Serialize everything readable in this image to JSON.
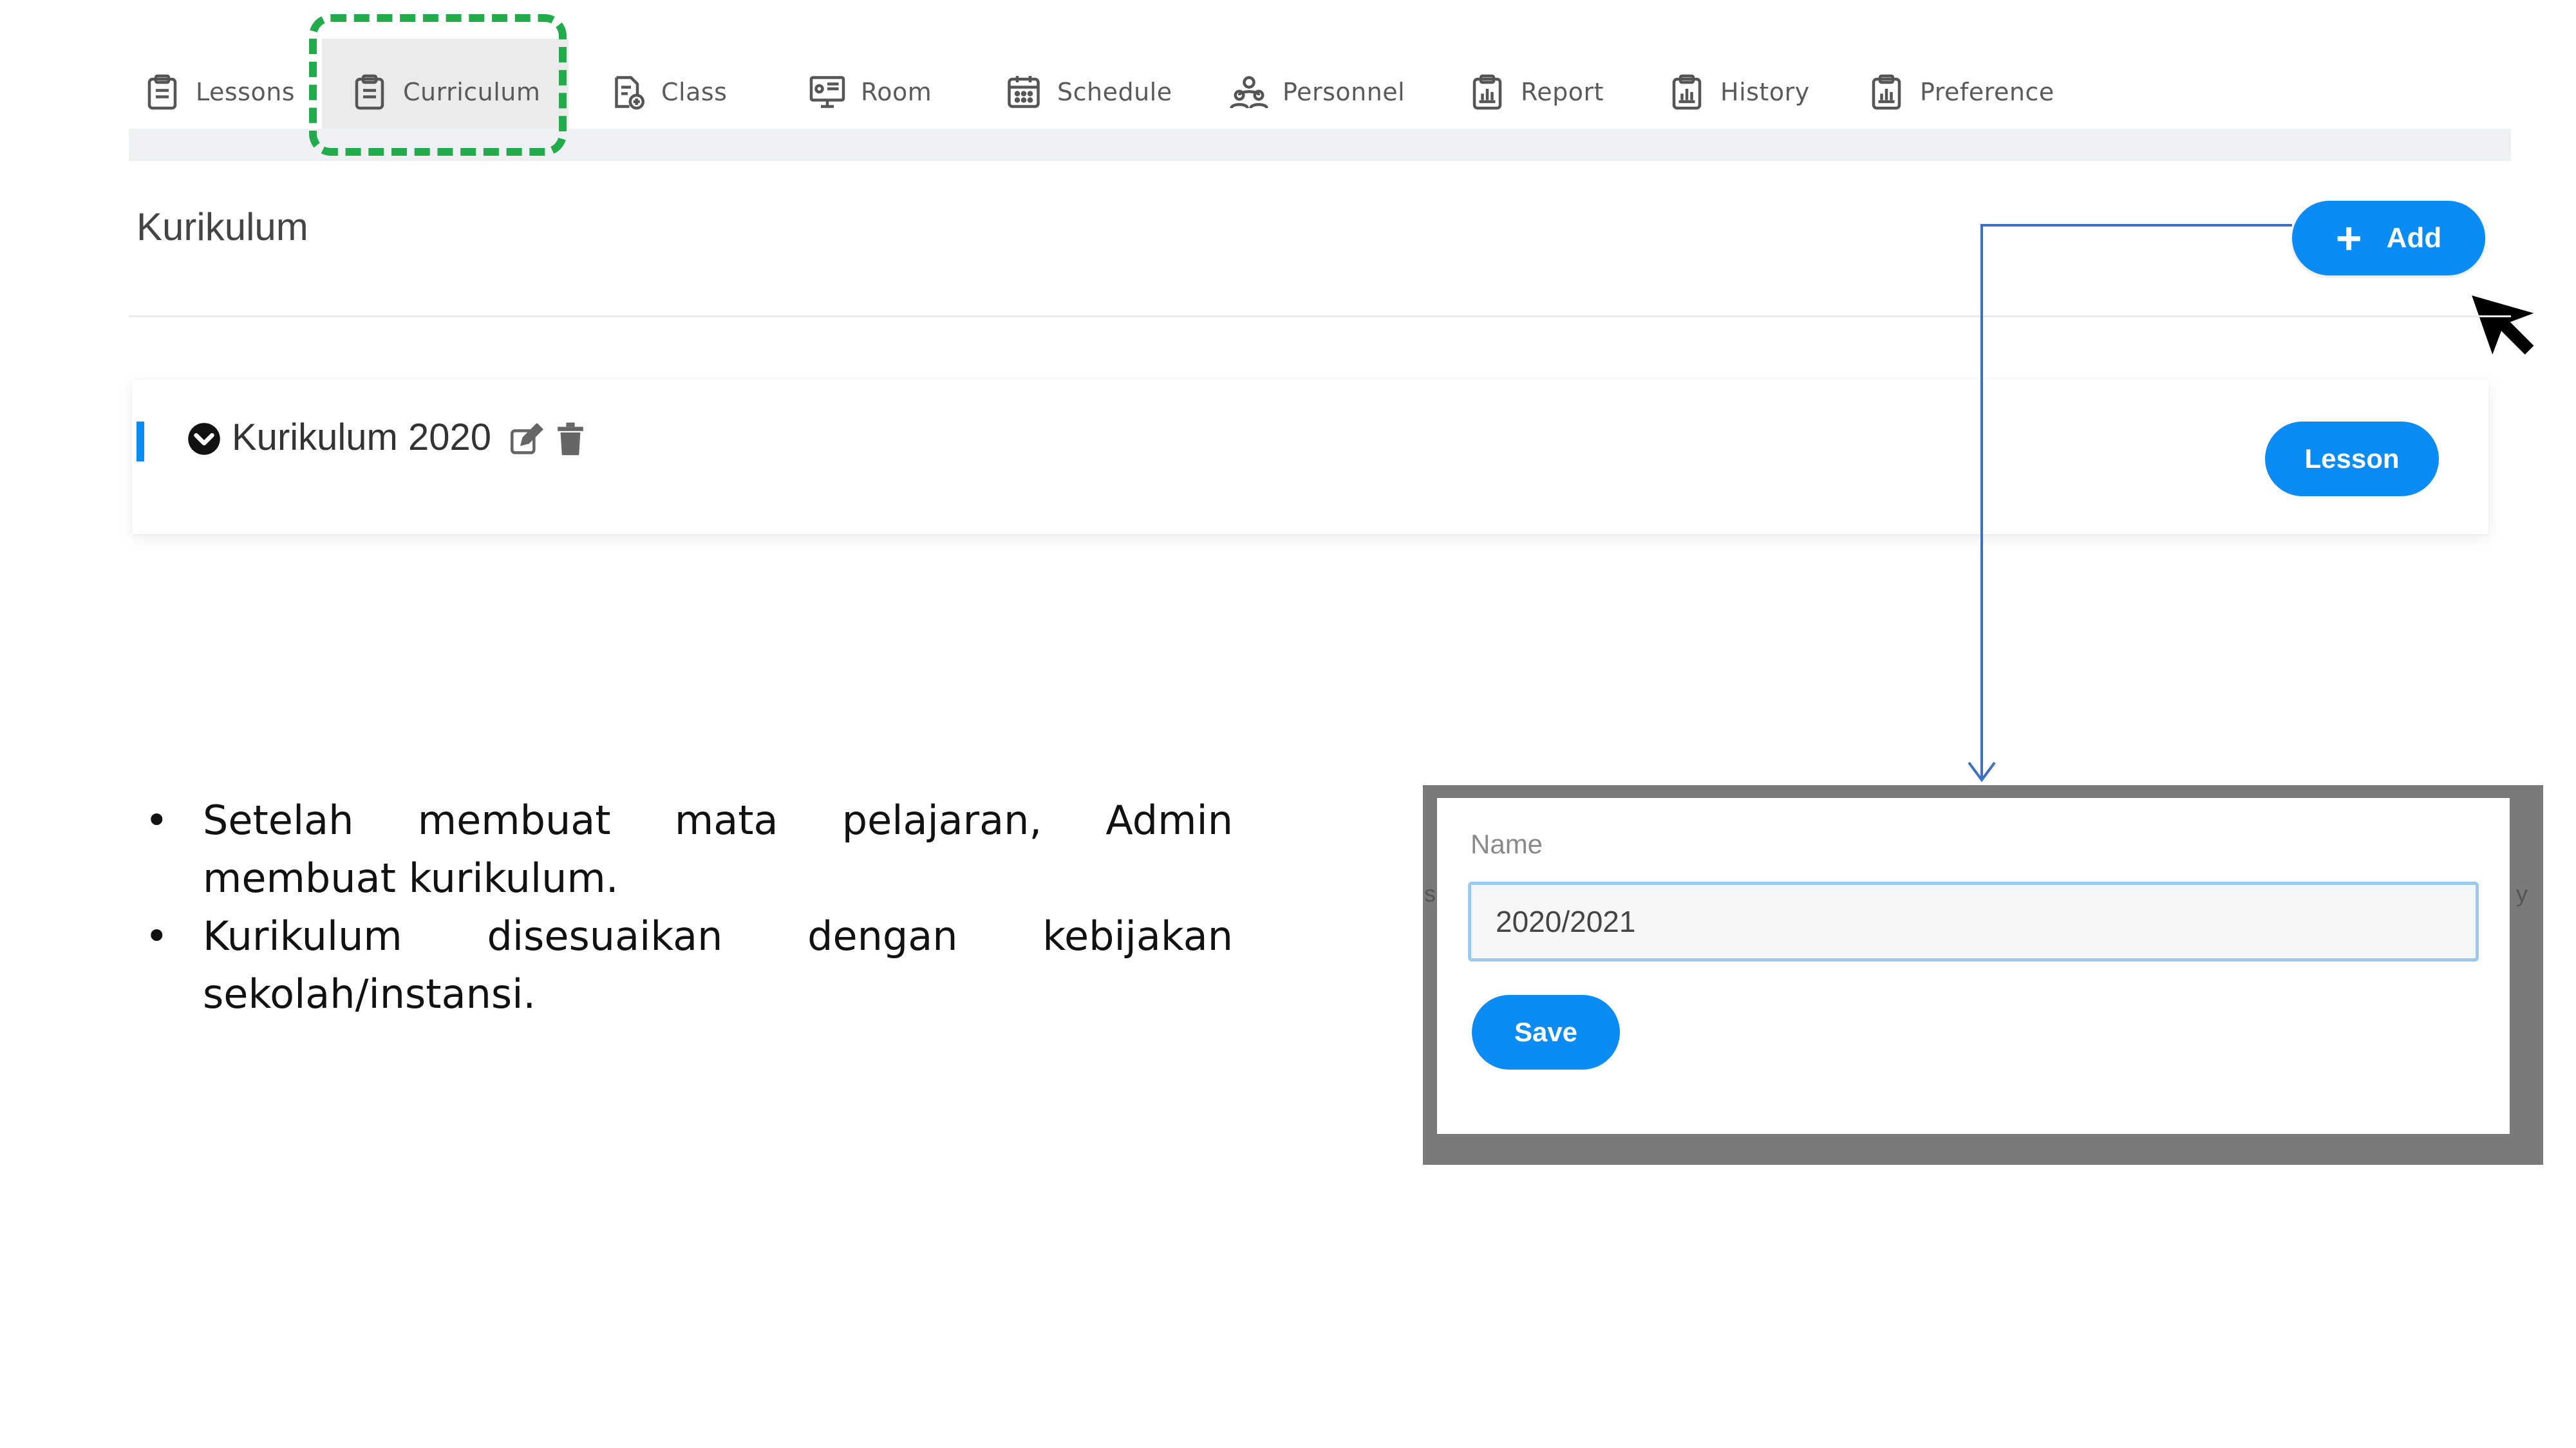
{
  "nav": {
    "items": [
      {
        "label": "Lessons",
        "icon": "clipboard-icon"
      },
      {
        "label": "Curriculum",
        "icon": "clipboard-icon",
        "active": true
      },
      {
        "label": "Class",
        "icon": "document-add-icon"
      },
      {
        "label": "Room",
        "icon": "presentation-board-icon"
      },
      {
        "label": "Schedule",
        "icon": "calendar-icon"
      },
      {
        "label": "Personnel",
        "icon": "people-icon"
      },
      {
        "label": "Report",
        "icon": "report-clipboard-icon"
      },
      {
        "label": "History",
        "icon": "report-clipboard-icon"
      },
      {
        "label": "Preference",
        "icon": "report-clipboard-icon"
      }
    ],
    "highlight_color": "#22ab4a"
  },
  "header": {
    "title": "Kurikulum",
    "add_label": "Add",
    "add_icon": "plus-icon"
  },
  "curriculum": {
    "items": [
      {
        "name": "Kurikulum 2020",
        "action_label": "Lesson",
        "expand_icon": "chevron-down-circle-icon",
        "edit_icon": "edit-icon",
        "delete_icon": "trash-icon"
      }
    ]
  },
  "notes": {
    "bullets": [
      "Setelah membuat mata pelajaran, Admin membuat kurikulum.",
      "Kurikulum disesuaikan dengan kebijakan sekolah/instansi."
    ]
  },
  "dialog": {
    "name_label": "Name",
    "name_value": "2020/2021",
    "save_label": "Save",
    "ghost_left": "s",
    "ghost_right": "y"
  },
  "colors": {
    "accent": "#0b8cf5",
    "connector": "#3d6fc4",
    "dialog_frame": "#7a7a7a"
  }
}
